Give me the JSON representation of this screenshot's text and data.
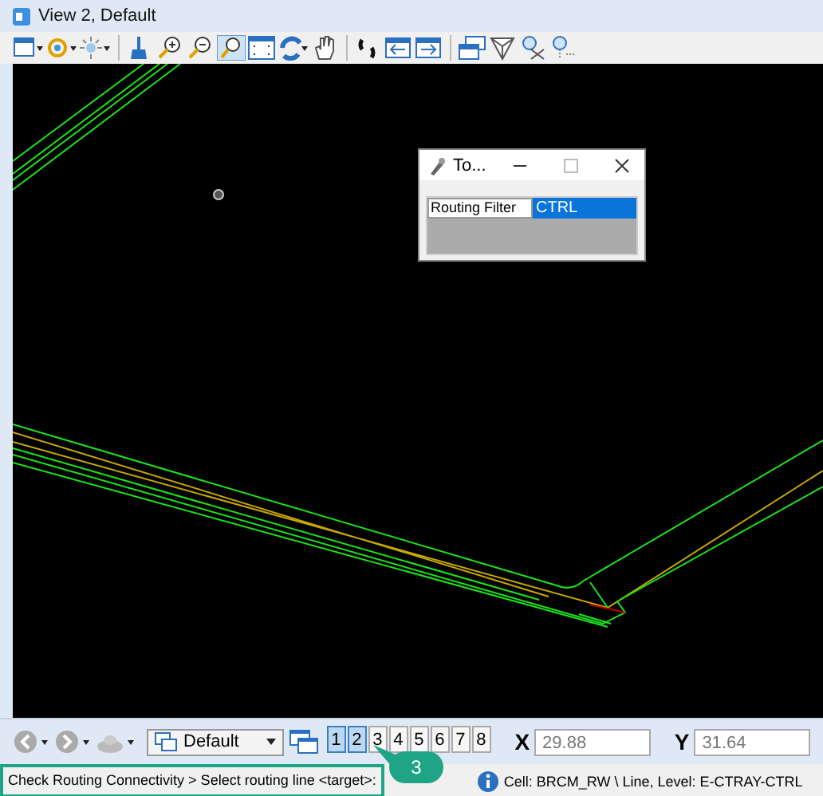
{
  "window": {
    "title": "View 2, Default"
  },
  "dialog": {
    "title": "To...",
    "rows": [
      {
        "label": "Routing Filter",
        "value": "CTRL",
        "selected": true
      }
    ]
  },
  "bottom_bar": {
    "view_group": "Default",
    "view_buttons": [
      {
        "label": "1",
        "selected": true
      },
      {
        "label": "2",
        "selected": true
      },
      {
        "label": "3",
        "selected": false
      },
      {
        "label": "4",
        "selected": false
      },
      {
        "label": "5",
        "selected": false
      },
      {
        "label": "6",
        "selected": false
      },
      {
        "label": "7",
        "selected": false
      },
      {
        "label": "8",
        "selected": false
      }
    ],
    "x": {
      "label": "X",
      "value": "29.88"
    },
    "y": {
      "label": "Y",
      "value": "31.64"
    }
  },
  "status_bar": {
    "prompt": "Check Routing Connectivity > Select routing line <target>:",
    "message": "Cell: BRCM_RW \\ Line, Level: E-CTRAY-CTRL"
  },
  "callout": {
    "label": "3"
  }
}
